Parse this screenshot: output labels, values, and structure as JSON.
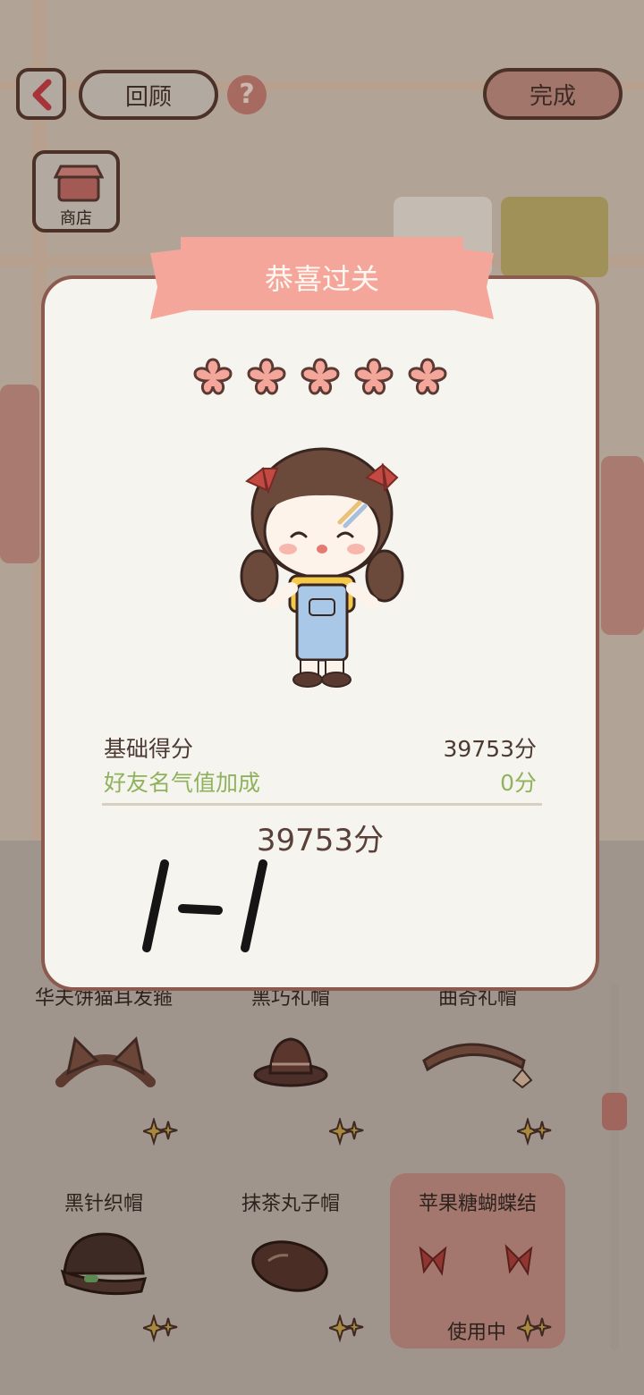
{
  "top_bar": {
    "back_label": "<",
    "review_label": "回顾",
    "help_label": "?",
    "done_label": "完成"
  },
  "shop": {
    "label": "商店"
  },
  "result": {
    "banner_title": "恭喜过关",
    "stars": 5,
    "base_score_label": "基础得分",
    "base_score_value": "39753分",
    "bonus_label": "好友名气值加成",
    "bonus_value": "0分",
    "total_score": "39753分",
    "handwritten_mark": "I-I"
  },
  "items": [
    {
      "name": "华夫饼猫耳发箍",
      "status": ""
    },
    {
      "name": "黑巧礼帽",
      "status": ""
    },
    {
      "name": "曲奇礼帽",
      "status": ""
    },
    {
      "name": "黑针织帽",
      "status": ""
    },
    {
      "name": "抹茶丸子帽",
      "status": ""
    },
    {
      "name": "苹果糖蝴蝶结",
      "status": "使用中"
    }
  ],
  "colors": {
    "accent": "#f5a69a",
    "done_bg": "#a3766c",
    "green": "#8fb25d",
    "modal_border": "#8c5a4f"
  }
}
